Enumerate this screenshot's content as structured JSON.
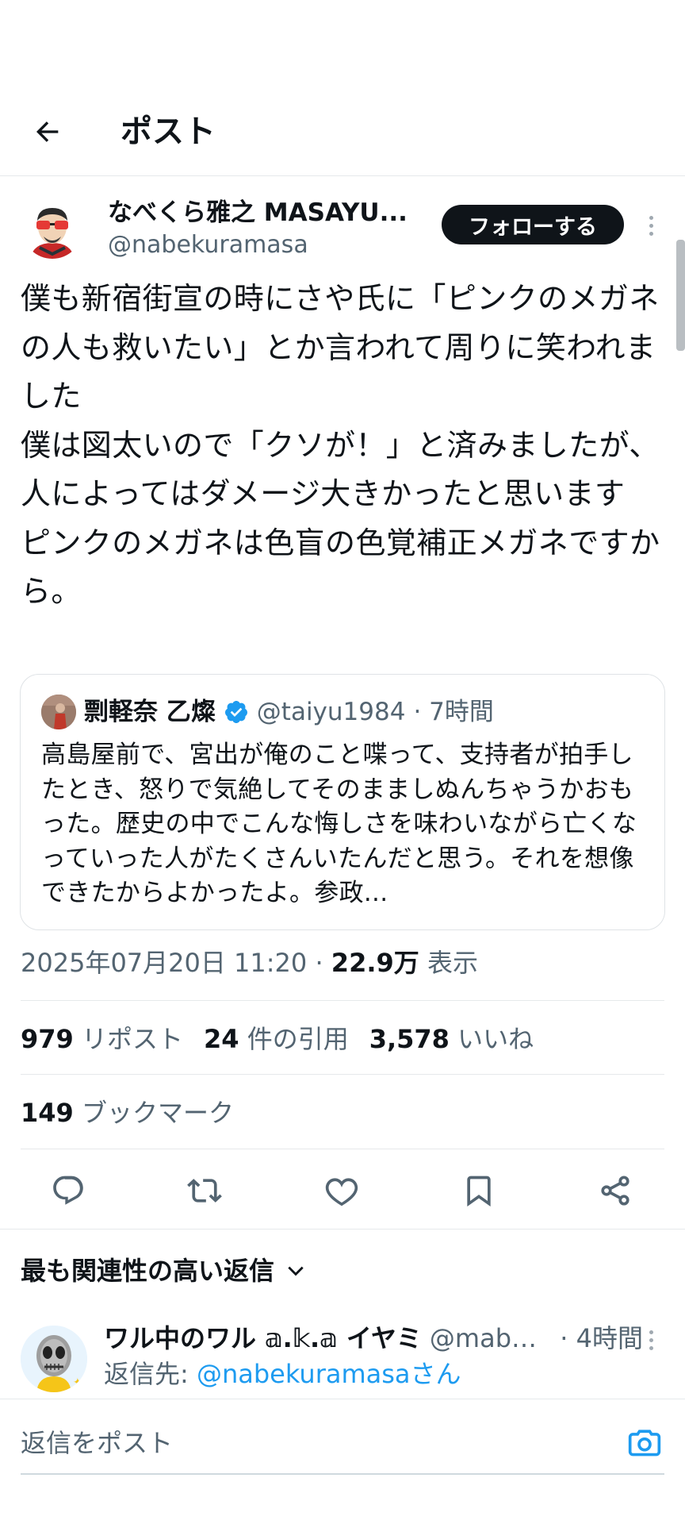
{
  "header": {
    "title": "ポスト"
  },
  "author": {
    "name": "なべくら雅之 MASAYU...",
    "handle": "@nabekuramasa",
    "follow_label": "フォローする"
  },
  "post": {
    "text": "僕も新宿街宣の時にさや氏に「ピンクのメガネの人も救いたい」とか言われて周りに笑われました\n僕は図太いので「クソが！」と済みましたが、人によってはダメージ大きかったと思います\nピンクのメガネは色盲の色覚補正メガネですから。"
  },
  "quote": {
    "name": "剽軽奈 乙燦",
    "handle": "@taiyu1984",
    "time": "· 7時間",
    "text": "高島屋前で、宮出が俺のこと喋って、支持者が拍手したとき、怒りで気絶してそのまましぬんちゃうかおもった。歴史の中でこんな悔しさを味わいながら亡くなっていった人がたくさんいたんだと思う。それを想像できたからよかったよ。参政..."
  },
  "meta": {
    "datetime": "2025年07月20日 11:20 · ",
    "views_count": "22.9万",
    "views_label": " 表示"
  },
  "stats": {
    "reposts_count": "979",
    "reposts_label": " リポスト",
    "quotes_count": "24",
    "quotes_label": " 件の引用",
    "likes_count": "3,578",
    "likes_label": " いいね",
    "bookmarks_count": "149",
    "bookmarks_label": " ブックマーク"
  },
  "actions": [
    "reply-icon",
    "repost-icon",
    "like-icon",
    "bookmark-icon",
    "share-icon"
  ],
  "replies": {
    "sort_label": "最も関連性の高い返信",
    "first": {
      "name": "ワル中のワル 𝕒.𝕜.𝕒 イヤミ",
      "handle": "@mabo...",
      "time": "· 4時間",
      "reply_to_prefix": "返信先: ",
      "reply_to_handle": "@nabekuramasa",
      "reply_to_suffix": "さん"
    }
  },
  "composer": {
    "placeholder": "返信をポスト"
  },
  "colors": {
    "accent": "#1d9bf0",
    "text": "#0f1419",
    "muted": "#536471",
    "border": "#e6e9eb"
  }
}
